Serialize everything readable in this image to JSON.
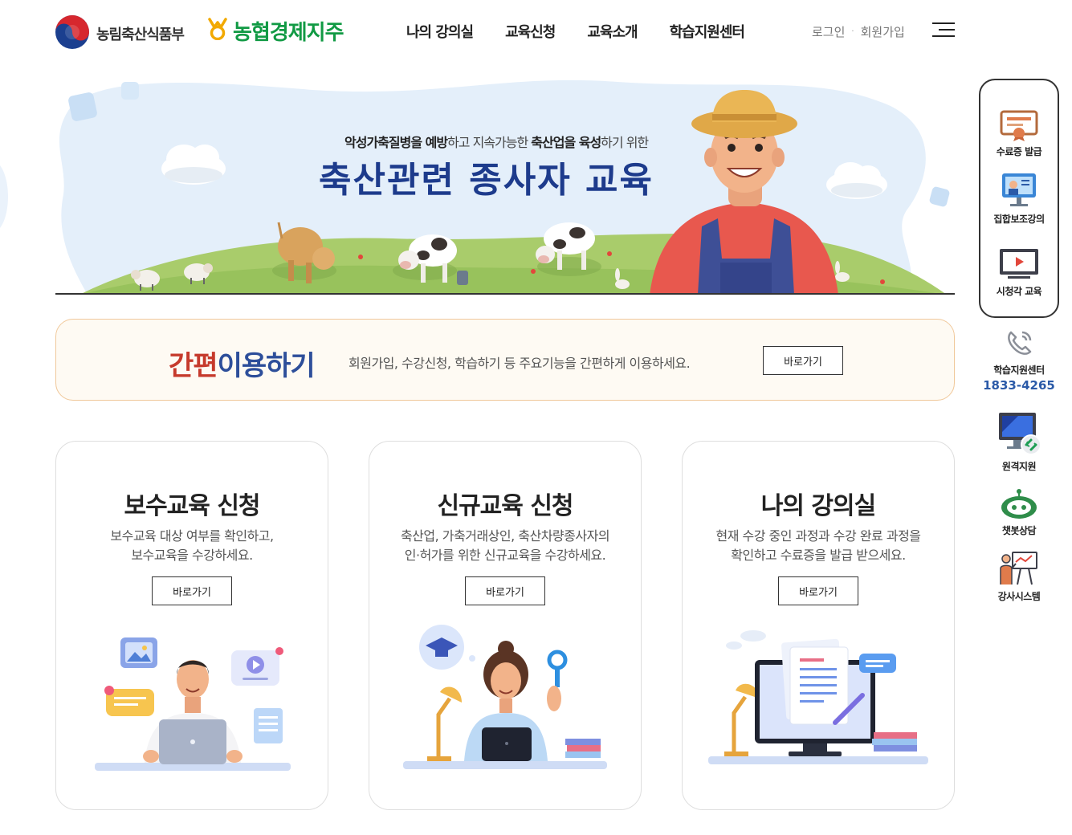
{
  "header": {
    "gov_name": "농림축산식품부",
    "nh_name": "농협경제지주",
    "nav": [
      "나의 강의실",
      "교육신청",
      "교육소개",
      "학습지원센터"
    ],
    "login": "로그인",
    "signup": "회원가입",
    "separator": "·"
  },
  "banner": {
    "subtitle_parts": [
      "악성가축질병을 예방",
      "하고 지속가능한 ",
      "축산업을 육성",
      "하기 위한"
    ],
    "title": "축산관련 종사자 교육"
  },
  "quick": {
    "title_red": "간편",
    "title_blue": "이용하기",
    "desc": "회원가입, 수강신청, 학습하기 등 주요기능을 간편하게 이용하세요.",
    "button": "바로가기"
  },
  "cards": [
    {
      "title": "보수교육 신청",
      "desc_line1": "보수교육 대상 여부를 확인하고,",
      "desc_line2": "보수교육을 수강하세요.",
      "button": "바로가기"
    },
    {
      "title": "신규교육 신청",
      "desc_line1": "축산업, 가축거래상인, 축산차량종사자의",
      "desc_line2": "인·허가를 위한 신규교육을 수강하세요.",
      "button": "바로가기"
    },
    {
      "title": "나의 강의실",
      "desc_line1": "현재 수강 중인 과정과 수강 완료 과정을",
      "desc_line2": "확인하고 수료증을 발급 받으세요.",
      "button": "바로가기"
    }
  ],
  "side_menu": {
    "boxed": [
      {
        "label": "수료증 발급",
        "icon": "certificate-icon"
      },
      {
        "label": "집합보조강의",
        "icon": "group-lecture-icon"
      },
      {
        "label": "시청각 교육",
        "icon": "video-monitor-icon"
      }
    ],
    "support": {
      "label": "학습지원센터",
      "phone": "1833-4265",
      "icon": "phone-icon"
    },
    "remote": {
      "label": "원격지원",
      "icon": "remote-support-icon"
    },
    "chatbot": {
      "label": "챗봇상담",
      "icon": "chatbot-icon"
    },
    "instructor": {
      "label": "강사시스템",
      "icon": "instructor-icon"
    }
  },
  "colors": {
    "brand_green": "#119a44",
    "banner_title": "#1d3b8c",
    "quick_red": "#c63a2c",
    "quick_blue": "#2d4e9a",
    "phone_blue": "#2b5aa8"
  }
}
